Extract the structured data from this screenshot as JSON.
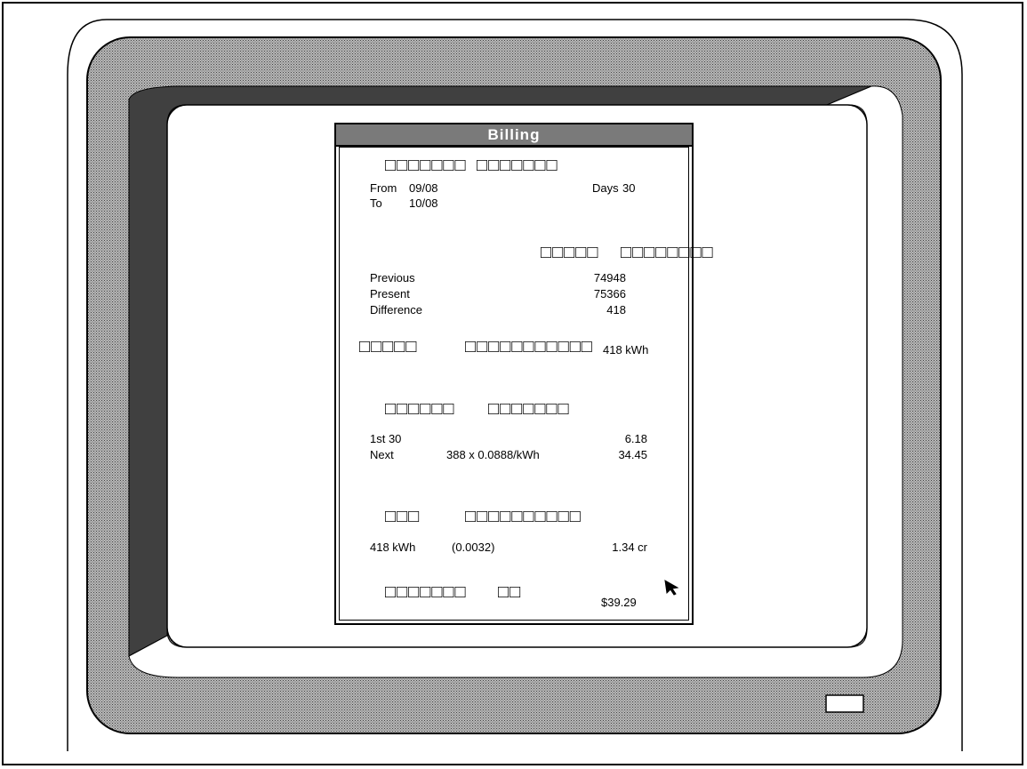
{
  "window": {
    "title": "Billing"
  },
  "period": {
    "heading_left": "□□□□□□□",
    "heading_right": "□□□□□□□",
    "from_label": "From",
    "from_value": "09/08",
    "to_label": "To",
    "to_value": "10/08",
    "days_label": "Days",
    "days_value": "30"
  },
  "meter": {
    "heading_left": "□□□□□",
    "heading_right": "□□□□□□□□",
    "rows": [
      {
        "label": "Previous",
        "value": "74948"
      },
      {
        "label": "Present",
        "value": "75366"
      },
      {
        "label": "Difference",
        "value": "418"
      }
    ]
  },
  "usage": {
    "heading_left": "□□□□□",
    "heading_right": "□□□□□□□□□□□",
    "value": "418 kWh"
  },
  "charges": {
    "heading_left": "□□□□□□",
    "heading_right": "□□□□□□□",
    "rows": [
      {
        "label": "1st 30",
        "detail": "",
        "value": "6.18"
      },
      {
        "label": "Next",
        "detail": "388 x 0.0888/kWh",
        "value": "34.45"
      }
    ]
  },
  "fuel": {
    "heading_left": "□□□",
    "heading_right": "□□□□□□□□□□",
    "kwh": "418 kWh",
    "rate": "(0.0032)",
    "value": "1.34 cr"
  },
  "total": {
    "heading_left": "□□□□□□□",
    "heading_right": "□□",
    "value": "$39.29"
  },
  "icons": {
    "cursor": "arrow-cursor-icon"
  },
  "colors": {
    "bezel": "#9a9a9a",
    "titlebar": "#7a7a7a",
    "outline": "#000000"
  }
}
